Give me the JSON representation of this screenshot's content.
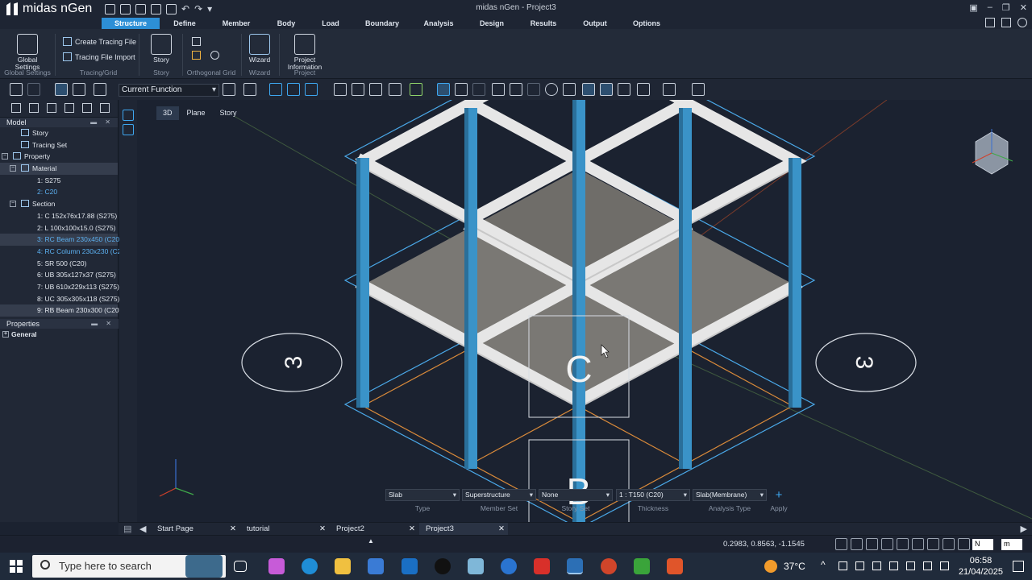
{
  "app": {
    "name": "midas nGen",
    "window_title": "midas nGen - Project3"
  },
  "menu": [
    {
      "label": "Structure",
      "active": true
    },
    {
      "label": "Define"
    },
    {
      "label": "Member"
    },
    {
      "label": "Body"
    },
    {
      "label": "Load"
    },
    {
      "label": "Boundary"
    },
    {
      "label": "Analysis"
    },
    {
      "label": "Design"
    },
    {
      "label": "Results"
    },
    {
      "label": "Output"
    },
    {
      "label": "Options"
    }
  ],
  "ribbon": {
    "global_settings": {
      "button": "Global Settings",
      "group": "Global Settings"
    },
    "tracing": {
      "create": "Create Tracing File",
      "import": "Tracing File Import",
      "group": "Tracing/Grid"
    },
    "story": {
      "button": "Story",
      "group": "Story"
    },
    "ortho": {
      "group": "Orthogonal Grid"
    },
    "wizard": {
      "button": "Wizard",
      "group": "Wizard"
    },
    "project": {
      "button": "Project Information",
      "group": "Project"
    }
  },
  "toolbar": {
    "function_combo": "Current Function"
  },
  "model_tree": {
    "header": "Model",
    "rows": [
      {
        "label": "Story",
        "indent": 1
      },
      {
        "label": "Tracing Set",
        "indent": 1
      },
      {
        "label": "Property",
        "indent": 0,
        "expander": "−"
      },
      {
        "label": "Material",
        "indent": 1,
        "expander": "−",
        "hl": true
      },
      {
        "label": "1: S275",
        "indent": 3
      },
      {
        "label": "2: C20",
        "indent": 3,
        "blue": true
      },
      {
        "label": "Section",
        "indent": 1,
        "expander": "−"
      },
      {
        "label": "1: C 152x76x17.88 (S275)",
        "indent": 3
      },
      {
        "label": "2: L 100x100x15.0 (S275)",
        "indent": 3
      },
      {
        "label": "3: RC Beam 230x450 (C20)",
        "indent": 3,
        "blue": true,
        "hl": true
      },
      {
        "label": "4: RC Column 230x230 (C20)",
        "indent": 3,
        "blue": true
      },
      {
        "label": "5: SR 500 (C20)",
        "indent": 3
      },
      {
        "label": "6: UB 305x127x37 (S275)",
        "indent": 3
      },
      {
        "label": "7: UB 610x229x113 (S275)",
        "indent": 3
      },
      {
        "label": "8: UC 305x305x118 (S275)",
        "indent": 3
      },
      {
        "label": "9: RB Beam 230x300 (C20)",
        "indent": 3,
        "hl": true
      }
    ]
  },
  "properties": {
    "header": "Properties",
    "group": "General"
  },
  "view_tabs": [
    "3D",
    "Plane",
    "Story"
  ],
  "viewport": {
    "grid_labels": {
      "c": "C",
      "b": "B",
      "left": "3",
      "right": "3"
    }
  },
  "slab_bar": {
    "type": {
      "value": "Slab",
      "label": "Type"
    },
    "member_set": {
      "value": "Superstructure",
      "label": "Member Set"
    },
    "story_set": {
      "value": "None",
      "label": "Story Set"
    },
    "thickness": {
      "value": "1 : T150 (C20)",
      "label": "Thickness"
    },
    "analysis_type": {
      "value": "Slab(Membrane)",
      "label": "Analysis Type"
    },
    "apply": {
      "label": "Apply"
    }
  },
  "doc_tabs": [
    {
      "label": "Start Page"
    },
    {
      "label": "tutorial"
    },
    {
      "label": "Project2"
    },
    {
      "label": "Project3",
      "active": true
    }
  ],
  "status": {
    "coords": "0.2983, 0.8563, -1.1545",
    "view_dir": "N",
    "unit": "m"
  },
  "taskbar": {
    "search_placeholder": "Type here to search",
    "temperature": "37°C",
    "time": "06:58",
    "date": "21/04/2025"
  },
  "colors": {
    "accent": "#2d8fd6",
    "column": "#3a93c8",
    "beam": "#e6e6e6",
    "slab": "#7a7874",
    "grid_blue": "#4aa8e8",
    "grid_orange": "#d98a3a"
  }
}
